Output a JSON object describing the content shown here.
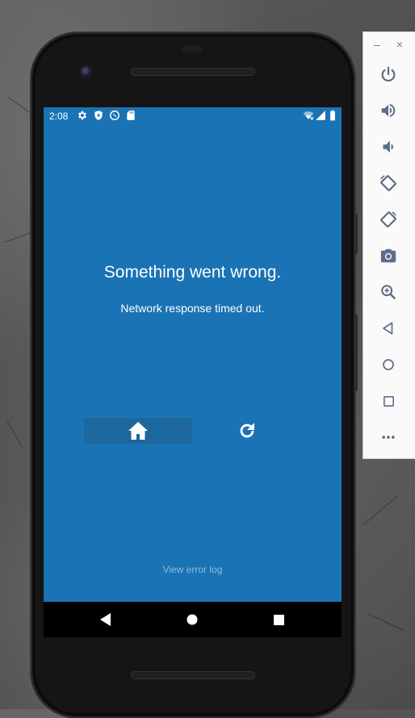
{
  "status_bar": {
    "time": "2:08",
    "left_icons": [
      "settings-icon",
      "shield-icon",
      "do-not-disturb-icon",
      "sd-card-icon"
    ],
    "right_icons": [
      "wifi-icon",
      "signal-icon",
      "battery-icon"
    ]
  },
  "error": {
    "title": "Something went wrong.",
    "message": "Network response timed out."
  },
  "actions": {
    "home_icon": "home-icon",
    "reload_icon": "reload-icon",
    "error_log_link": "View error log"
  },
  "navigation_bar": {
    "buttons": [
      "back-icon",
      "home-circle-icon",
      "overview-icon"
    ]
  },
  "emulator_toolbar": {
    "window_controls": {
      "minimize": "–",
      "close": "×"
    },
    "tools": [
      "power-icon",
      "volume-up-icon",
      "volume-down-icon",
      "rotate-left-icon",
      "rotate-right-icon",
      "camera-icon",
      "zoom-icon",
      "back-icon",
      "home-icon",
      "overview-icon",
      "more-icon"
    ]
  },
  "colors": {
    "screen_background": "#1a73b4",
    "home_button_background": "#1d679f",
    "link_text": "#8bbbe0",
    "toolbar_icon": "#5a6e86"
  }
}
